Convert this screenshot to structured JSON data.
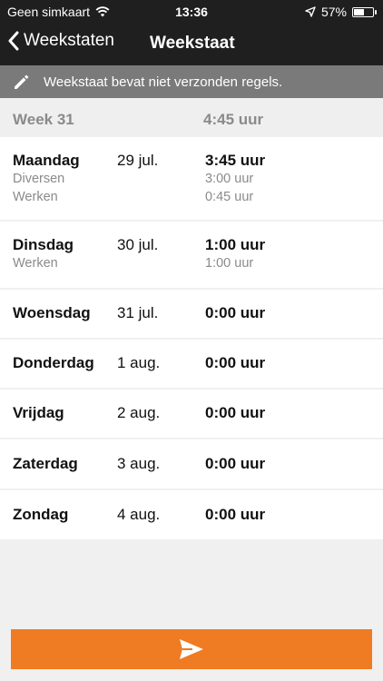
{
  "status_bar": {
    "carrier": "Geen simkaart",
    "time": "13:36",
    "battery": "57%",
    "battery_level": 0.57
  },
  "nav": {
    "back_label": "Weekstaten",
    "title": "Weekstaat"
  },
  "banner": {
    "text": "Weekstaat bevat niet verzonden regels."
  },
  "week": {
    "label": "Week 31",
    "total": "4:45 uur"
  },
  "days": [
    {
      "name": "Maandag",
      "date": "29 jul.",
      "hours": "3:45 uur",
      "entries": [
        {
          "type": "Diversen",
          "hours": "3:00 uur"
        },
        {
          "type": "Werken",
          "hours": "0:45 uur"
        }
      ]
    },
    {
      "name": "Dinsdag",
      "date": "30 jul.",
      "hours": "1:00 uur",
      "entries": [
        {
          "type": "Werken",
          "hours": "1:00 uur"
        }
      ]
    },
    {
      "name": "Woensdag",
      "date": "31 jul.",
      "hours": "0:00 uur",
      "entries": []
    },
    {
      "name": "Donderdag",
      "date": "1 aug.",
      "hours": "0:00 uur",
      "entries": []
    },
    {
      "name": "Vrijdag",
      "date": "2 aug.",
      "hours": "0:00 uur",
      "entries": []
    },
    {
      "name": "Zaterdag",
      "date": "3 aug.",
      "hours": "0:00 uur",
      "entries": []
    },
    {
      "name": "Zondag",
      "date": "4 aug.",
      "hours": "0:00 uur",
      "entries": []
    }
  ],
  "colors": {
    "accent": "#ef7b22",
    "header": "#1f1f1f",
    "banner": "#7a7a7a"
  },
  "icons": {
    "back": "chevron-left-icon",
    "banner": "pencil-icon",
    "send": "send-icon"
  }
}
